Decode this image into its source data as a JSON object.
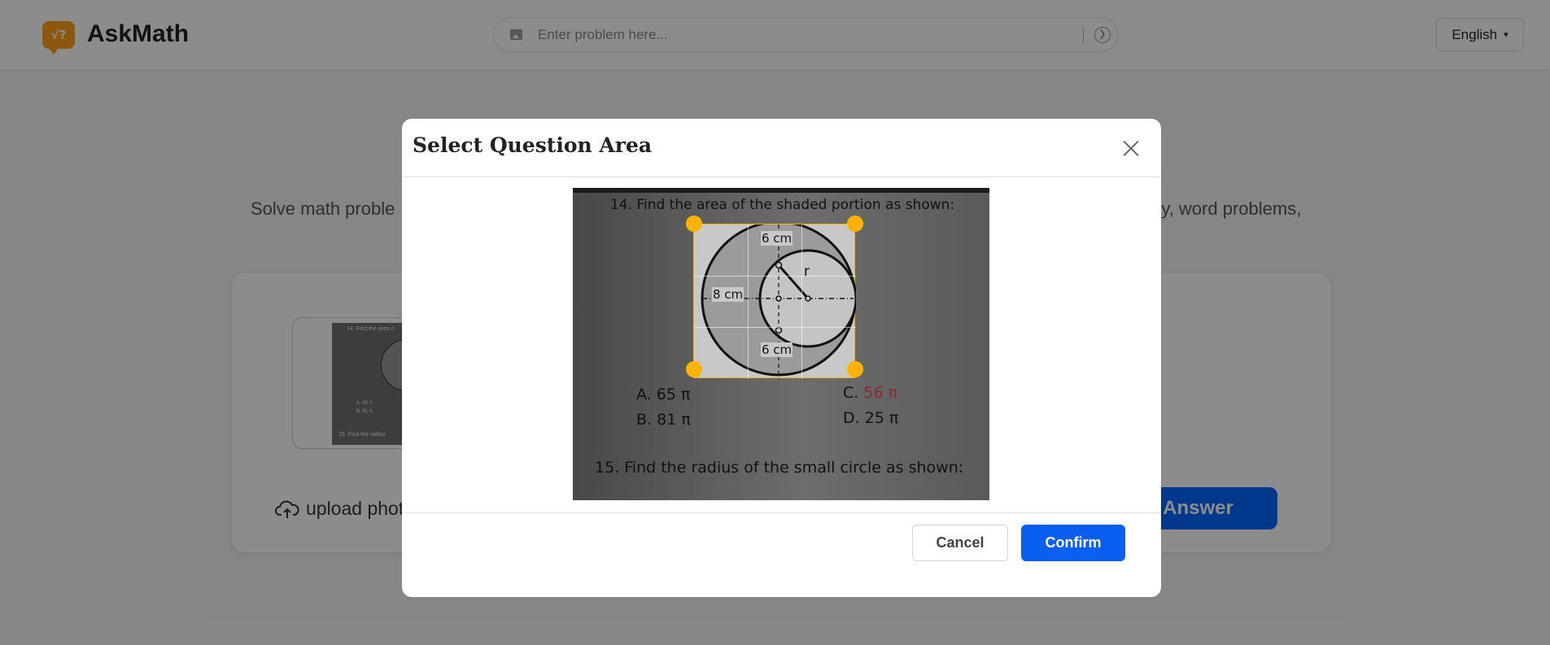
{
  "header": {
    "logo_glyph": "√?",
    "brand": "AskMath",
    "search": {
      "placeholder": "Enter problem here...",
      "value": ""
    },
    "language": {
      "selected": "English",
      "arrow": "▾"
    }
  },
  "hero": {
    "subtitle_left": "Solve math proble",
    "subtitle_right": "ry, word problems,"
  },
  "card": {
    "thumbnail": {
      "line1": "14.  Find the area o",
      "line2": "A.   65 π",
      "line3": "B.   81 π",
      "line4": "15.  Find the radius"
    },
    "upload_label": "upload phot",
    "answer_label": "Answer"
  },
  "modal": {
    "title": "Select Question Area",
    "photo": {
      "question14": "14.  Find the area of the shaded portion as shown:",
      "diagram": {
        "top": "6 cm",
        "left": "8 cm",
        "radius": "r",
        "bottom": "6 cm"
      },
      "option_a": "A.    65 π",
      "option_b": "B.    81 π",
      "option_c_prefix": "C. ",
      "option_c_value": "56 π",
      "option_d": "D. 25 π",
      "question15": "15.  Find the radius of the small circle as shown:"
    },
    "cancel_label": "Cancel",
    "confirm_label": "Confirm"
  },
  "colors": {
    "brand_orange": "#ff9f1c",
    "primary_blue": "#0a5ff0",
    "crop_handle": "#ffb300",
    "overlay": "rgba(0,0,0,0.45)"
  }
}
